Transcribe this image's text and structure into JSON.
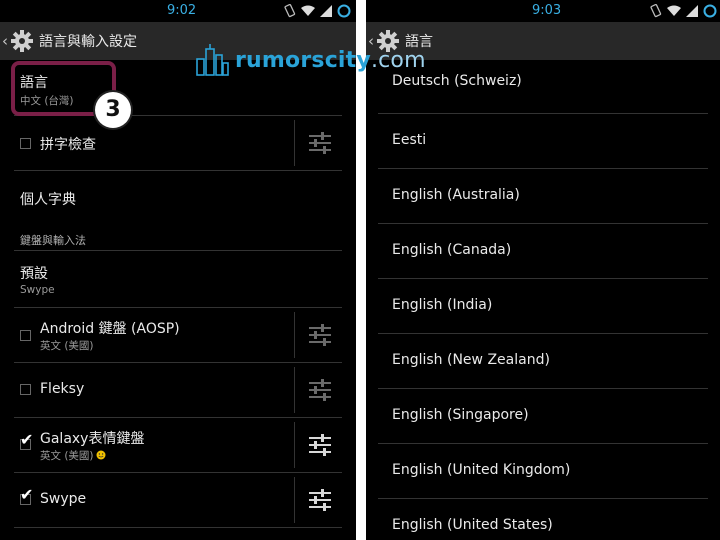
{
  "left": {
    "status": {
      "time": "9:02"
    },
    "title": "語言與輸入設定",
    "items": {
      "language": {
        "label": "語言",
        "value": "中文 (台灣)"
      },
      "spell": {
        "label": "拼字檢查"
      },
      "dict": {
        "label": "個人字典"
      },
      "section": "鍵盤與輸入法",
      "default_kb": {
        "label": "預設",
        "value": "Swype"
      },
      "android": {
        "label": "Android 鍵盤 (AOSP)",
        "sub": "英文 (美國)"
      },
      "fleksy": {
        "label": "Fleksy"
      },
      "galaxy": {
        "label": "Galaxy表情鍵盤",
        "sub": "英文 (美國)"
      },
      "swype": {
        "label": "Swype"
      }
    },
    "badge": "3"
  },
  "right": {
    "status": {
      "time": "9:03"
    },
    "title": "語言",
    "languages": [
      "Deutsch (Schweiz)",
      "Eesti",
      "English (Australia)",
      "English (Canada)",
      "English (India)",
      "English (New Zealand)",
      "English (Singapore)",
      "English (United Kingdom)",
      "English (United States)"
    ]
  },
  "watermark": {
    "name": "rumorscity",
    "tld": ".com"
  },
  "colors": {
    "accent": "#3ab0e4",
    "highlight": "#7a1f47",
    "watermark": "#2aa3d8"
  }
}
